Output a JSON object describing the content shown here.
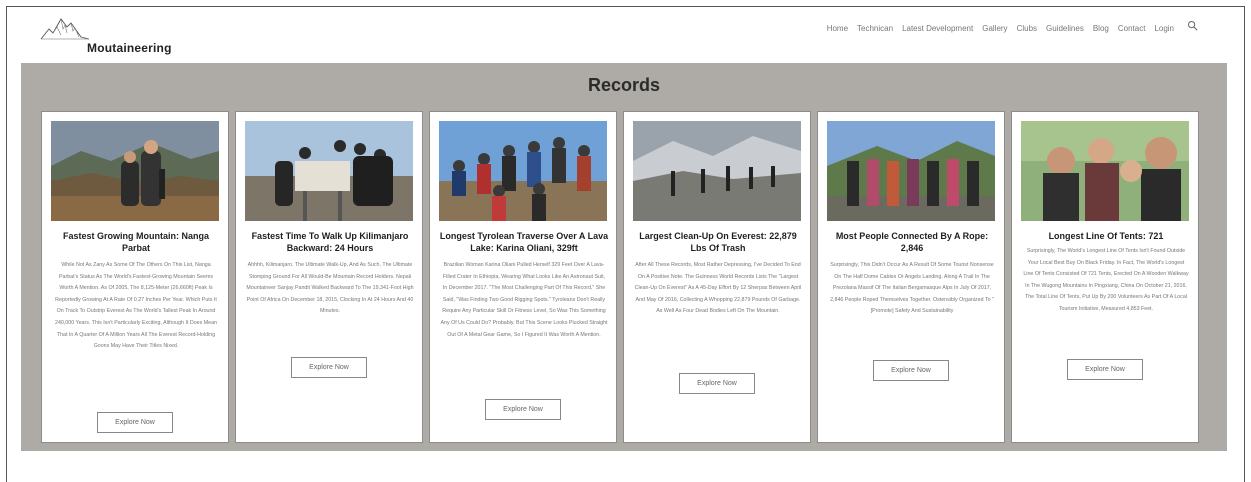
{
  "brand": {
    "name": "Moutaineering"
  },
  "nav": {
    "items": [
      "Home",
      "Technican",
      "Latest Development",
      "Gallery",
      "Clubs",
      "Guidelines",
      "Blog",
      "Contact",
      "Login"
    ]
  },
  "records": {
    "title": "Records",
    "cards": [
      {
        "title": "Fastest Growing Mountain: Nanga Parbat",
        "text": "While Not As Zany As Some Of The Others On This List, Nanga Parbat's Status As The World's Fastest-Growing Mountain Seems Worth A Mention. As Of 2005, The 8,125-Meter (26,660ft) Peak Is Reportedly Growing At A Rate Of 0.27 Inches Per Year. Which Puts It On Track To Outstrip Everest As The World's Tallest Peak In Around 240,000 Years. This Isn't Particularly Exciting, Although It Does Mean That In A Quarter Of A Million Years All The Everest Record-Holding Goons May Have Their Titles Nixed.",
        "button": "Explore Now"
      },
      {
        "title": "Fastest Time To Walk Up Kilimanjaro Backward: 24 Hours",
        "text": "Ahhhh, Kilimanjaro. The Ultimate Walk-Up, And As Such, The Ultimate Stomping Ground For All Would-Be Mountain Record Holders. Nepali Mountaineer Sanjay Pandit Walked Backward To The 19,341-Foot High Point Of Africa On December 18, 2015, Clocking In At 24 Hours And 40 Minutes.",
        "button": "Explore Now"
      },
      {
        "title": "Longest Tyrolean Traverse Over A Lava Lake: Karina Oliani, 329ft",
        "text": "Brazilian Woman Karina Oliani Pulled Herself 329 Feet Over A Lava-Filled Crater In Ethiopia, Wearing What Looks Like An Astronaut Suit, In December 2017. \"The Most Challenging Part Of This Record,\" She Said, \"Was Finding Two Good Rigging Spots.\" Tyroleans Don't Really Require Any Particular Skill Or Fitness Level, So Was This Something Any Of Us Could Do? Probably. But This Scene Looks Plucked Straight Out Of A Metal Gear Game, So I Figured It Was Worth A Mention.",
        "button": "Explore Now"
      },
      {
        "title": "Largest Clean-Up On Everest: 22,879 Lbs Of Trash",
        "text": "After All These Records, Most Rather Depressing, I've Decided To End On A Positive Note. The Guinness World Records Lists The \"Largest Clean-Up On Everest\" As A 45-Day Effort By 12 Sherpas Between April And May Of 2016, Collecting A Whopping 22,879 Pounds Of Garbage. As Well As Four Dead Bodies Left On The Mountain.",
        "button": "Explore Now"
      },
      {
        "title": "Most People Connected By A Rope: 2,846",
        "text": "Surprisingly, This Didn't Occur As A Result Of Some Tourist Nonsense On The Half Dome Cables Or Angels Landing. Along A Trail In The Prezolana Massif Of The Italian Bergamasque Alps In July Of 2017, 2,846 People Roped Themselves Together. Ostensibly Organized To \"[Promote] Safety And Sustainability",
        "button": "Explore Now"
      },
      {
        "title": "Longest Line Of Tents: 721",
        "text": "Surprisingly, The World's Longest Line Of Tents Isn't Found Outside Your Local Best Buy On Black Friday. In Fact, The World's Longest Line Of Tents Consisted Of 721 Tents, Erected On A Wooden Walkway In The Wugong Mountains In Pingxiang, China On October 21, 2016. The Total Line Of Tents, Put Up By 200 Volunteers As Part Of A Local Tourism Initiative, Measured 4,853 Feet.",
        "button": "Explore Now"
      }
    ]
  }
}
